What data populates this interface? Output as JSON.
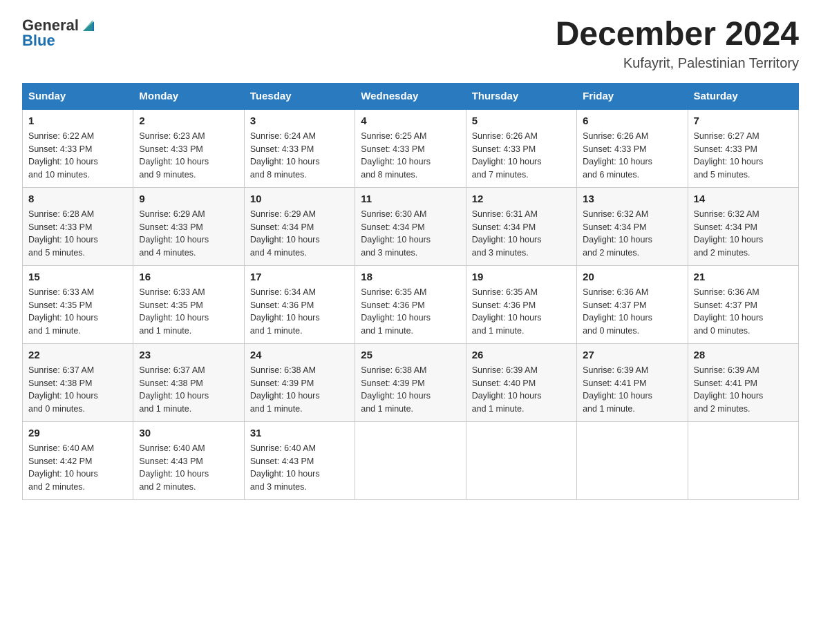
{
  "logo": {
    "general": "General",
    "blue": "Blue"
  },
  "header": {
    "month_year": "December 2024",
    "location": "Kufayrit, Palestinian Territory"
  },
  "days_of_week": [
    "Sunday",
    "Monday",
    "Tuesday",
    "Wednesday",
    "Thursday",
    "Friday",
    "Saturday"
  ],
  "weeks": [
    [
      {
        "day": "1",
        "sunrise": "6:22 AM",
        "sunset": "4:33 PM",
        "daylight": "10 hours and 10 minutes."
      },
      {
        "day": "2",
        "sunrise": "6:23 AM",
        "sunset": "4:33 PM",
        "daylight": "10 hours and 9 minutes."
      },
      {
        "day": "3",
        "sunrise": "6:24 AM",
        "sunset": "4:33 PM",
        "daylight": "10 hours and 8 minutes."
      },
      {
        "day": "4",
        "sunrise": "6:25 AM",
        "sunset": "4:33 PM",
        "daylight": "10 hours and 8 minutes."
      },
      {
        "day": "5",
        "sunrise": "6:26 AM",
        "sunset": "4:33 PM",
        "daylight": "10 hours and 7 minutes."
      },
      {
        "day": "6",
        "sunrise": "6:26 AM",
        "sunset": "4:33 PM",
        "daylight": "10 hours and 6 minutes."
      },
      {
        "day": "7",
        "sunrise": "6:27 AM",
        "sunset": "4:33 PM",
        "daylight": "10 hours and 5 minutes."
      }
    ],
    [
      {
        "day": "8",
        "sunrise": "6:28 AM",
        "sunset": "4:33 PM",
        "daylight": "10 hours and 5 minutes."
      },
      {
        "day": "9",
        "sunrise": "6:29 AM",
        "sunset": "4:33 PM",
        "daylight": "10 hours and 4 minutes."
      },
      {
        "day": "10",
        "sunrise": "6:29 AM",
        "sunset": "4:34 PM",
        "daylight": "10 hours and 4 minutes."
      },
      {
        "day": "11",
        "sunrise": "6:30 AM",
        "sunset": "4:34 PM",
        "daylight": "10 hours and 3 minutes."
      },
      {
        "day": "12",
        "sunrise": "6:31 AM",
        "sunset": "4:34 PM",
        "daylight": "10 hours and 3 minutes."
      },
      {
        "day": "13",
        "sunrise": "6:32 AM",
        "sunset": "4:34 PM",
        "daylight": "10 hours and 2 minutes."
      },
      {
        "day": "14",
        "sunrise": "6:32 AM",
        "sunset": "4:34 PM",
        "daylight": "10 hours and 2 minutes."
      }
    ],
    [
      {
        "day": "15",
        "sunrise": "6:33 AM",
        "sunset": "4:35 PM",
        "daylight": "10 hours and 1 minute."
      },
      {
        "day": "16",
        "sunrise": "6:33 AM",
        "sunset": "4:35 PM",
        "daylight": "10 hours and 1 minute."
      },
      {
        "day": "17",
        "sunrise": "6:34 AM",
        "sunset": "4:36 PM",
        "daylight": "10 hours and 1 minute."
      },
      {
        "day": "18",
        "sunrise": "6:35 AM",
        "sunset": "4:36 PM",
        "daylight": "10 hours and 1 minute."
      },
      {
        "day": "19",
        "sunrise": "6:35 AM",
        "sunset": "4:36 PM",
        "daylight": "10 hours and 1 minute."
      },
      {
        "day": "20",
        "sunrise": "6:36 AM",
        "sunset": "4:37 PM",
        "daylight": "10 hours and 0 minutes."
      },
      {
        "day": "21",
        "sunrise": "6:36 AM",
        "sunset": "4:37 PM",
        "daylight": "10 hours and 0 minutes."
      }
    ],
    [
      {
        "day": "22",
        "sunrise": "6:37 AM",
        "sunset": "4:38 PM",
        "daylight": "10 hours and 0 minutes."
      },
      {
        "day": "23",
        "sunrise": "6:37 AM",
        "sunset": "4:38 PM",
        "daylight": "10 hours and 1 minute."
      },
      {
        "day": "24",
        "sunrise": "6:38 AM",
        "sunset": "4:39 PM",
        "daylight": "10 hours and 1 minute."
      },
      {
        "day": "25",
        "sunrise": "6:38 AM",
        "sunset": "4:39 PM",
        "daylight": "10 hours and 1 minute."
      },
      {
        "day": "26",
        "sunrise": "6:39 AM",
        "sunset": "4:40 PM",
        "daylight": "10 hours and 1 minute."
      },
      {
        "day": "27",
        "sunrise": "6:39 AM",
        "sunset": "4:41 PM",
        "daylight": "10 hours and 1 minute."
      },
      {
        "day": "28",
        "sunrise": "6:39 AM",
        "sunset": "4:41 PM",
        "daylight": "10 hours and 2 minutes."
      }
    ],
    [
      {
        "day": "29",
        "sunrise": "6:40 AM",
        "sunset": "4:42 PM",
        "daylight": "10 hours and 2 minutes."
      },
      {
        "day": "30",
        "sunrise": "6:40 AM",
        "sunset": "4:43 PM",
        "daylight": "10 hours and 2 minutes."
      },
      {
        "day": "31",
        "sunrise": "6:40 AM",
        "sunset": "4:43 PM",
        "daylight": "10 hours and 3 minutes."
      },
      null,
      null,
      null,
      null
    ]
  ],
  "labels": {
    "sunrise": "Sunrise:",
    "sunset": "Sunset:",
    "daylight": "Daylight:"
  }
}
